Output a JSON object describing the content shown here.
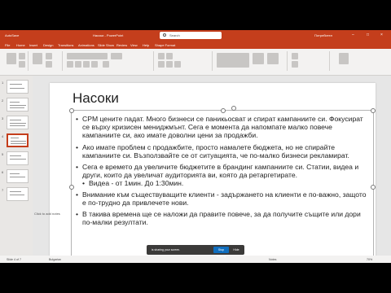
{
  "app": {
    "title_left": "AutoSave",
    "title": "Насоки - PowerPoint",
    "search_placeholder": "Search",
    "user": "Потребител",
    "minimize": "–",
    "maximize": "□",
    "close": "×"
  },
  "ribbon": {
    "tabs": [
      "File",
      "Home",
      "Insert",
      "Design",
      "Transitions",
      "Animations",
      "Slide Show",
      "Review",
      "View",
      "Help",
      "Shape Format"
    ]
  },
  "thumbnails": [
    "1",
    "2",
    "3",
    "4",
    "5",
    "6",
    "7"
  ],
  "slide": {
    "title": "Насоки",
    "bullets": [
      "CPM цените падат. Много бизнеси се паникьосват и спират кампаниите си. Фокусират се върху кризисен мениджмънт. Сега е момента да напомпате малко повече кампаниите си, ако имате доволни цени за продажби.",
      "Ако имате проблем с продажбите, просто намалете бюджета, но не спирайте кампаниите си. Възползвайте се от ситуацията, че по-малко бизнеси рекламират.",
      "Сега е времето да увеличите бюджетите в брандинг кампаниите си. Статии, видеа и други, които да увеличат аудиторията ви, която да ретаргетирате.",
      "Видеа - от 1мин. До 1:30мин.",
      "Внимание към съществуващите клиенти - задържането на клиенти е по-важно, защото е по-трудно да привлечете нови.",
      "В такива времена ще се наложи да правите повече, за да получите същите или дори по-малки резултати."
    ]
  },
  "notes_placeholder": "Click to add notes",
  "status": {
    "slide_info": "Slide 4 of 7",
    "language": "Bulgarian",
    "notes": "Notes",
    "zoom": "70%"
  },
  "share_bar": {
    "message": "is sharing your screen.",
    "stop": "Stop sharing",
    "hide": "Hide"
  }
}
